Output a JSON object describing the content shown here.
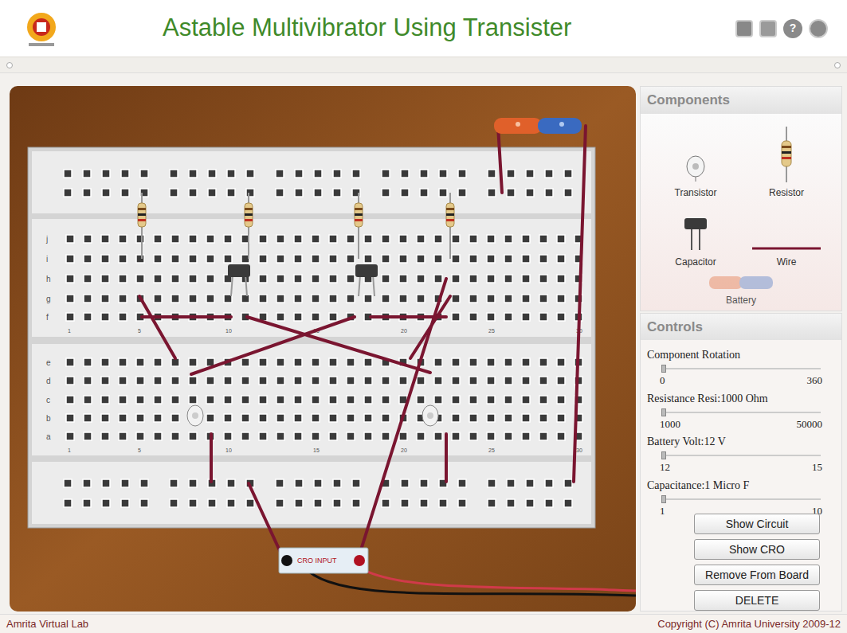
{
  "header": {
    "title": "Astable Multivibrator Using Transister",
    "help_icon": "?"
  },
  "breadboard": {
    "row_labels_top": [
      "j",
      "i",
      "h",
      "g",
      "f"
    ],
    "row_labels_bottom": [
      "e",
      "d",
      "c",
      "b",
      "a"
    ],
    "column_numbers": [
      "1",
      "5",
      "10",
      "15",
      "20",
      "25",
      "30"
    ],
    "cro_label": "CRO INPUT"
  },
  "components": {
    "title": "Components",
    "items": [
      {
        "label": "Transistor",
        "kind": "transistor",
        "disabled": false
      },
      {
        "label": "Resistor",
        "kind": "resistor",
        "disabled": false
      },
      {
        "label": "Capacitor",
        "kind": "capacitor",
        "disabled": false
      },
      {
        "label": "Wire",
        "kind": "wire",
        "disabled": false
      },
      {
        "label": "Battery",
        "kind": "battery",
        "disabled": true
      }
    ]
  },
  "controls": {
    "title": "Controls",
    "sliders": [
      {
        "label": "Component Rotation",
        "min": "0",
        "max": "360",
        "level": 0
      },
      {
        "label": "Resistance Resi:1000 Ohm",
        "min": "1000",
        "max": "50000",
        "level": 0
      },
      {
        "label": "Battery Volt:12 V",
        "min": "12",
        "max": "15",
        "level": 0
      },
      {
        "label": "Capacitance:1 Micro F",
        "min": "1",
        "max": "10",
        "level": 0
      }
    ],
    "buttons": [
      "Show Circuit",
      "Show CRO",
      "Remove From Board",
      "DELETE"
    ]
  },
  "footer": {
    "left": "Amrita Virtual Lab",
    "right": "Copyright (C) Amrita University 2009-12"
  }
}
